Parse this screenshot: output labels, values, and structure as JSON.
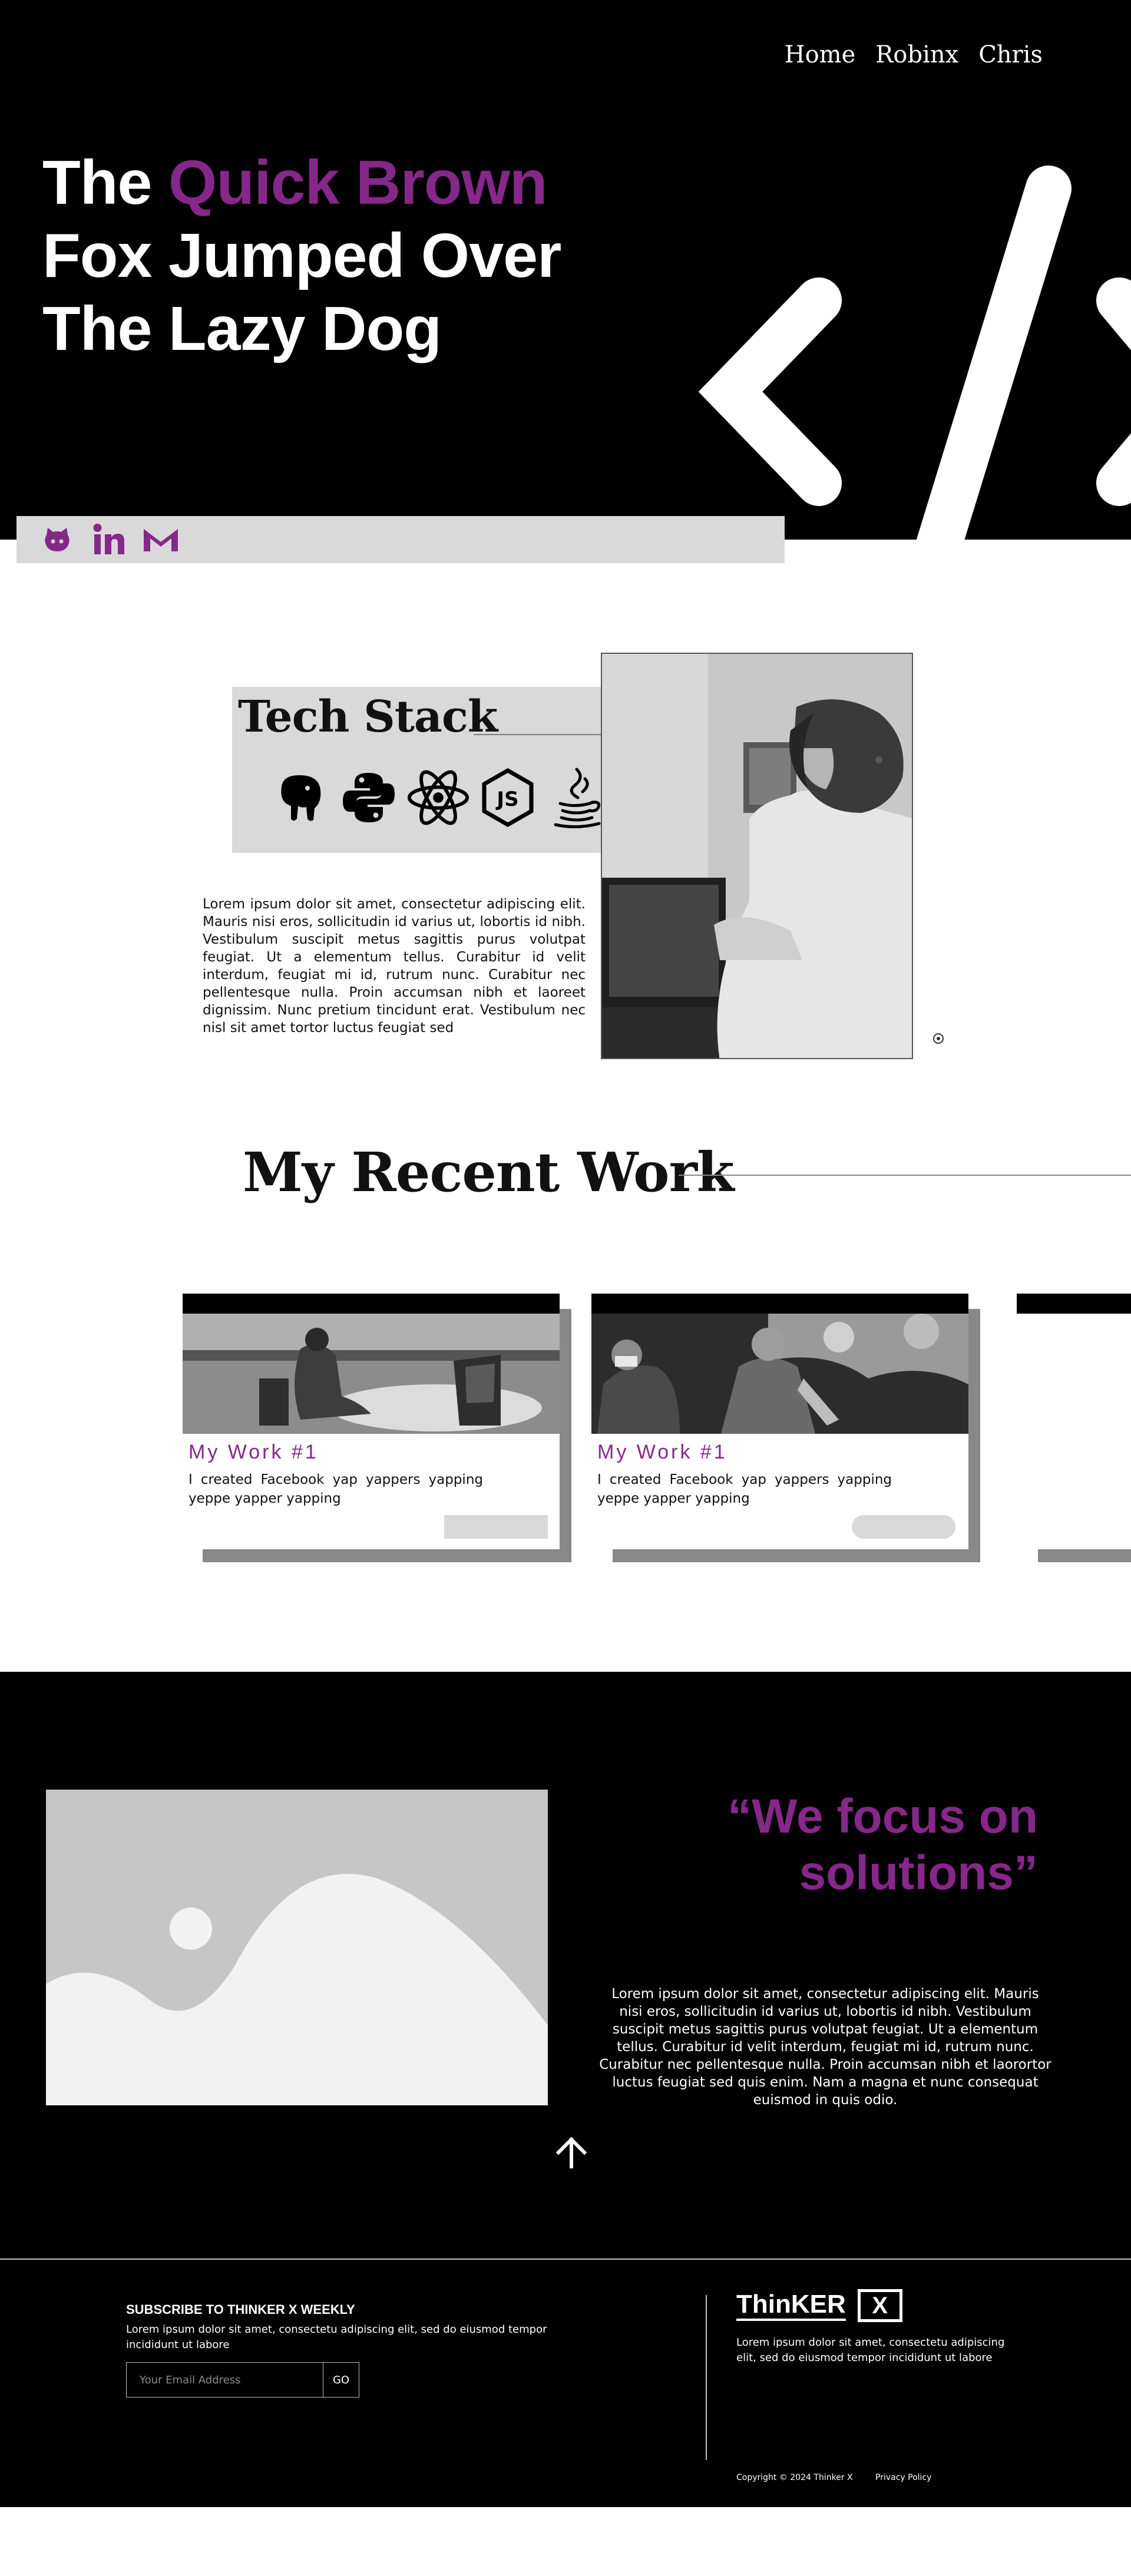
{
  "nav": {
    "items": [
      {
        "label": "Home"
      },
      {
        "label": "Robinx"
      },
      {
        "label": "Chris"
      }
    ]
  },
  "hero": {
    "title_part1": "The ",
    "title_accent": "Quick Brown",
    "title_part2": " Fox Jumped Over The Lazy Dog",
    "accent_color": "#86278a",
    "graphic_icon": "code-brackets-icon"
  },
  "social": {
    "icons": [
      "github-icon",
      "linkedin-icon",
      "gmail-icon"
    ],
    "color": "#86278a"
  },
  "tech_stack": {
    "title": "Tech Stack",
    "icons": [
      "postgresql-icon",
      "python-icon",
      "react-icon",
      "nodejs-icon",
      "java-icon"
    ],
    "description": "Lorem ipsum dolor sit amet, consectetur adipiscing elit. Mauris nisi eros, sollicitudin id varius ut, lobortis id nibh. Vestibulum suscipit metus sagittis purus volutpat feugiat. Ut a elementum tellus. Curabitur id velit interdum, feugiat mi id, rutrum nunc. Curabitur nec pellentesque nulla. Proin accumsan nibh et laoreet dignissim. Nunc pretium tincidunt erat. Vestibulum nec nisl sit amet tortor luctus feugiat sed",
    "photo_icon": "person-at-laptop-photo"
  },
  "recent_work": {
    "title": "My Recent Work",
    "cards": [
      {
        "title": "My Work #1",
        "description": "I created Facebook yap yappers yapping yeppe yapper yapping"
      },
      {
        "title": "My Work #1",
        "description": "I created Facebook yap yappers yapping yeppe yapper yapping"
      }
    ]
  },
  "focus": {
    "quote": "“We focus on solutions”",
    "description": "Lorem ipsum dolor sit amet, consectetur adipiscing elit. Mauris nisi eros, sollicitudin id varius ut, lobortis id nibh. Vestibulum suscipit metus sagittis purus volutpat feugiat. Ut a elementum tellus. Curabitur id velit interdum, feugiat mi id, rutrum nunc. Curabitur nec pellentesque nulla. Proin accumsan nibh et laorortor luctus feugiat sed quis enim. Nam a magna et nunc consequat euismod in quis odio.",
    "image_icon": "image-placeholder-icon",
    "scroll_icon": "arrow-up-icon"
  },
  "footer": {
    "subscribe_title": "SUBSCRIBE TO THINKER X WEEKLY",
    "subscribe_text": "Lorem ipsum dolor sit amet, consectetu adipiscing elit, sed do eiusmod tempor incididunt ut labore",
    "email_placeholder": "Your Email Address",
    "go_label": "GO",
    "logo_text": "ThinKER",
    "logo_box": "X",
    "about_text": "Lorem ipsum dolor sit amet, consectetu adipiscing elit, sed do eiusmod tempor incididunt ut labore",
    "copyright": "Copyright © 2024 Thinker X",
    "privacy": "Privacy Policy"
  }
}
